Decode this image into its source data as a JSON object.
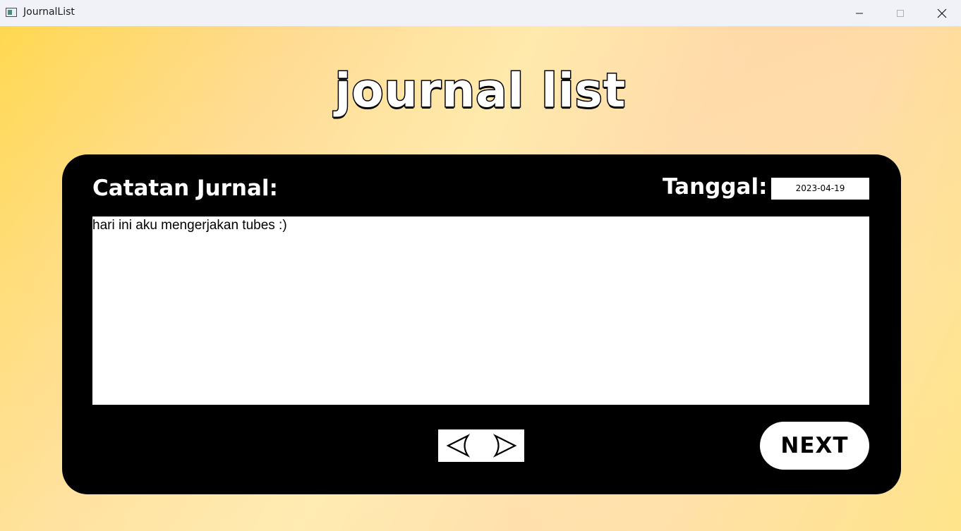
{
  "window": {
    "title": "JournalList",
    "icon": "app-window-icon",
    "controls": [
      "minimize-icon",
      "maximize-icon",
      "close-icon"
    ]
  },
  "page": {
    "title": "journal list"
  },
  "panel": {
    "notes_label": "Catatan Jurnal:",
    "date_label": "Tanggal:",
    "date_value": "2023-04-19",
    "journal_text": "hari ini aku mengerjakan tubes :)",
    "prev_icon": "arrow-left-icon",
    "next_icon": "arrow-right-icon",
    "next_button_label": "NEXT"
  },
  "colors": {
    "panel_background": "#000000",
    "background_gradient": [
      "#ffd850",
      "#ffe8a8",
      "#ffd4a4",
      "#ffdc5c"
    ]
  }
}
